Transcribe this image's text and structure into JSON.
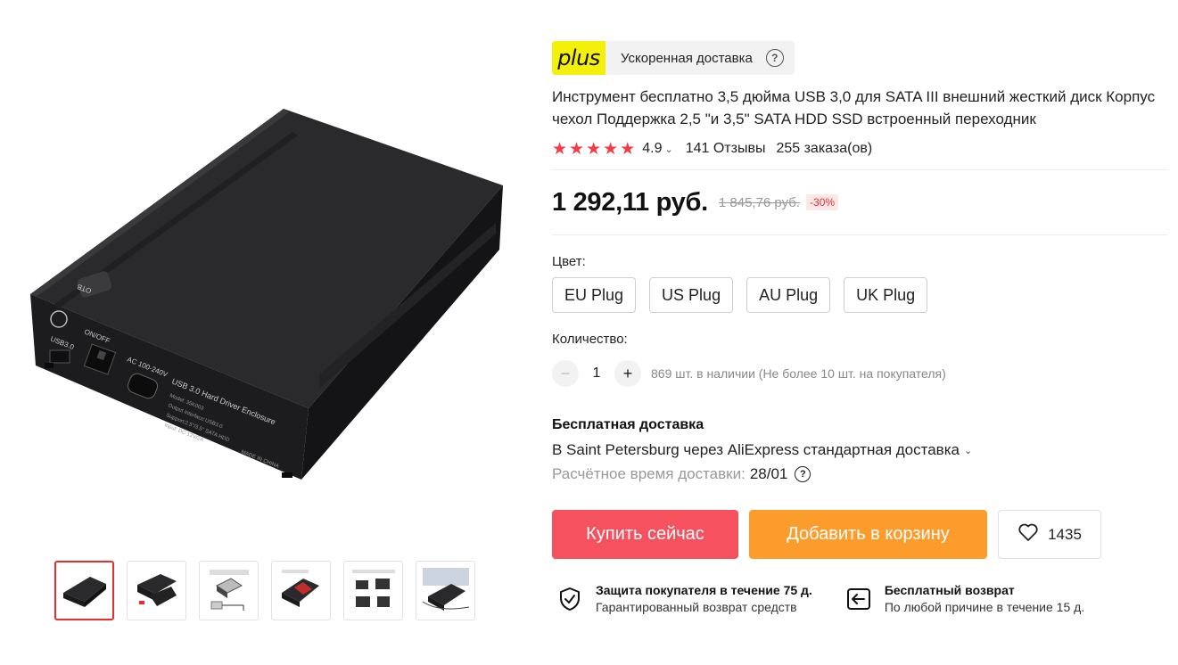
{
  "delivery_banner": {
    "logo_text": "plus",
    "text": "Ускоренная доставка",
    "help_icon": "?"
  },
  "product": {
    "title": "Инструмент бесплатно 3,5 дюйма USB 3,0 для SATA III внешний жесткий диск Корпус чехол Поддержка 2,5 \"и 3,5\" SATA HDD SSD встроенный переходник",
    "rating": "4.9",
    "stars": 5,
    "reviews": "141 Отзывы",
    "orders": "255 заказа(ов)"
  },
  "price": {
    "current": "1 292,11 руб.",
    "old": "1 845,76 руб.",
    "discount": "-30%"
  },
  "color": {
    "label": "Цвет:",
    "options": [
      "EU Plug",
      "US Plug",
      "AU Plug",
      "UK Plug"
    ]
  },
  "quantity": {
    "label": "Количество:",
    "value": "1",
    "minus": "−",
    "plus": "+",
    "stock": "869 шт. в наличии (Не более 10 шт. на покупателя)"
  },
  "shipping": {
    "title": "Бесплатная доставка",
    "line": "В Saint Petersburg через AliExpress стандартная доставка",
    "eta_label": "Расчётное время доставки:",
    "eta_value": "28/01",
    "eta_help": "?"
  },
  "actions": {
    "buy": "Купить сейчас",
    "cart": "Добавить в корзину",
    "wishlist_count": "1435"
  },
  "guarantees": [
    {
      "title": "Защита покупателя в течение 75 д.",
      "subtitle": "Гарантированный возврат средств",
      "icon": "shield-check-icon"
    },
    {
      "title": "Бесплатный возврат",
      "subtitle": "По любой причине в течение 15 д.",
      "icon": "return-icon"
    }
  ],
  "gallery": {
    "thumbnails": 6,
    "active_index": 0
  },
  "image_labels": {
    "otb": "OTB",
    "usb": "USB3.0",
    "onoff": "ON/OFF",
    "ac": "AC 100-240V",
    "enclosure": "USB 3.0 Hard Driver Enclosure",
    "made": "MADE IN CHINA"
  },
  "colors": {
    "accent_red": "#f5515f",
    "accent_orange": "#fb9c2c",
    "star": "#f53b46",
    "plus_yellow": "#f5f00a"
  }
}
